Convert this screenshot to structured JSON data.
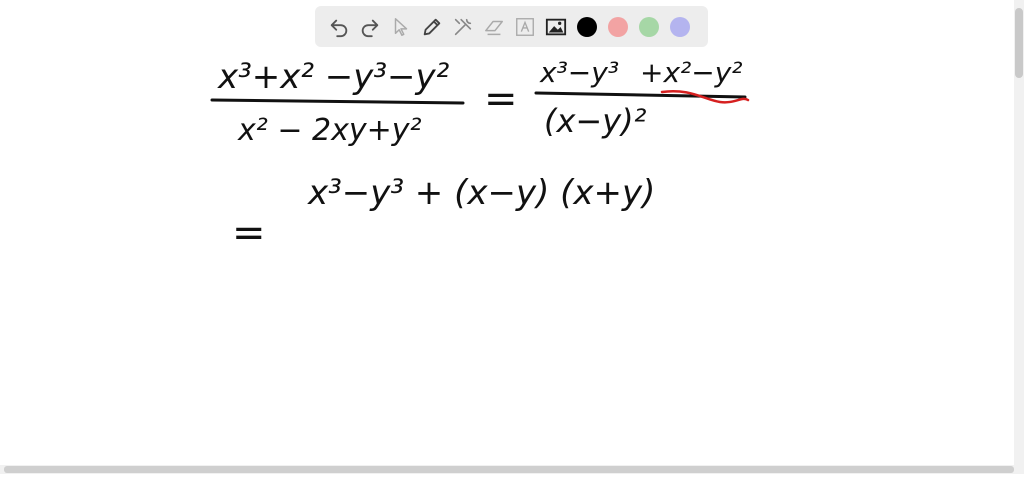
{
  "toolbar": {
    "tools": [
      {
        "name": "undo-icon"
      },
      {
        "name": "redo-icon"
      },
      {
        "name": "pointer-icon"
      },
      {
        "name": "pen-icon"
      },
      {
        "name": "tools-icon"
      },
      {
        "name": "eraser-icon"
      },
      {
        "name": "text-icon"
      },
      {
        "name": "image-icon"
      }
    ],
    "colors": [
      "#000000",
      "#f2a3a3",
      "#a6d7a6",
      "#b4b4ef"
    ]
  },
  "math": {
    "lhs_num": "x³+x² −y³−y²",
    "lhs_den": "x² − 2xy+y²",
    "eq1": "=",
    "rhs_num_a": "x³−y³",
    "rhs_num_b": "+x²−y²",
    "rhs_den": "(x−y)²",
    "line2": "x³−y³  + (x−y) (x+y)",
    "eq2": "="
  }
}
